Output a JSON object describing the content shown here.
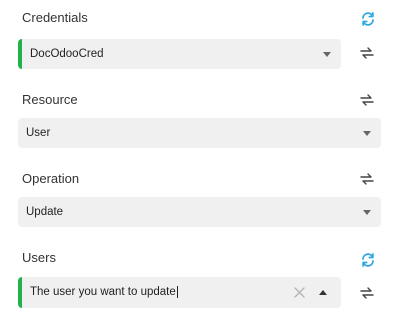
{
  "credentials": {
    "label": "Credentials",
    "value": "DocOdooCred"
  },
  "resource": {
    "label": "Resource",
    "value": "User"
  },
  "operation": {
    "label": "Operation",
    "value": "Update"
  },
  "users": {
    "label": "Users",
    "placeholder": "The user you want to update"
  },
  "colors": {
    "accent_green": "#21b24b",
    "refresh_blue": "#2fa8e0",
    "field_bg": "#f0f0f0"
  },
  "icons": {
    "refresh": "refresh-icon",
    "swap": "swap-arrows-icon",
    "clear": "clear-x-icon"
  }
}
